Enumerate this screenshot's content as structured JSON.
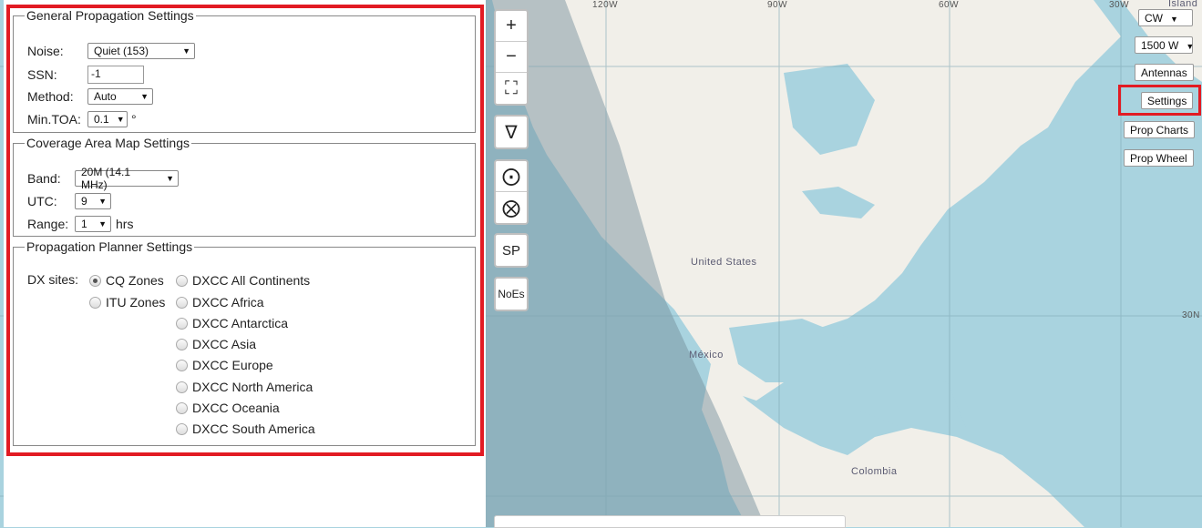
{
  "map": {
    "grid_labels": [
      "120W",
      "90W",
      "60W",
      "30W",
      "30N"
    ],
    "places": [
      "United States",
      "México",
      "Colombia",
      "Island"
    ]
  },
  "tools": {
    "zoom_in": "+",
    "zoom_out": "−",
    "fullscreen": "⛶",
    "nabla": "∇",
    "sun": "⨀",
    "moon": "⨂",
    "sp": "SP",
    "noes": "NoEs"
  },
  "right_controls": {
    "mode": "CW",
    "power": "1500 W",
    "antennas": "Antennas",
    "settings": "Settings",
    "prop_charts": "Prop Charts",
    "prop_wheel": "Prop Wheel"
  },
  "general": {
    "legend": "General Propagation Settings",
    "noise_label": "Noise:",
    "noise_value": "Quiet (153)",
    "ssn_label": "SSN:",
    "ssn_value": "-1",
    "method_label": "Method:",
    "method_value": "Auto",
    "mintoa_label": "Min.TOA:",
    "mintoa_value": "0.1",
    "mintoa_unit": "°"
  },
  "coverage": {
    "legend": "Coverage Area Map Settings",
    "band_label": "Band:",
    "band_value": "20M (14.1 MHz)",
    "utc_label": "UTC:",
    "utc_value": "9",
    "range_label": "Range:",
    "range_value": "1",
    "range_unit": "hrs"
  },
  "planner": {
    "legend": "Propagation Planner Settings",
    "dx_label": "DX sites:",
    "zones": [
      {
        "label": "CQ Zones",
        "checked": true
      },
      {
        "label": "ITU Zones",
        "checked": false
      }
    ],
    "dxcc": [
      {
        "label": "DXCC All Continents",
        "checked": false
      },
      {
        "label": "DXCC Africa",
        "checked": false
      },
      {
        "label": "DXCC Antarctica",
        "checked": false
      },
      {
        "label": "DXCC Asia",
        "checked": false
      },
      {
        "label": "DXCC Europe",
        "checked": false
      },
      {
        "label": "DXCC North America",
        "checked": false
      },
      {
        "label": "DXCC Oceania",
        "checked": false
      },
      {
        "label": "DXCC South America",
        "checked": false
      }
    ]
  },
  "colors": {
    "highlight": "#e21b23",
    "ocean": "#a9d3df",
    "land": "#f1efe9",
    "night_shade": "#8aa7b3"
  }
}
